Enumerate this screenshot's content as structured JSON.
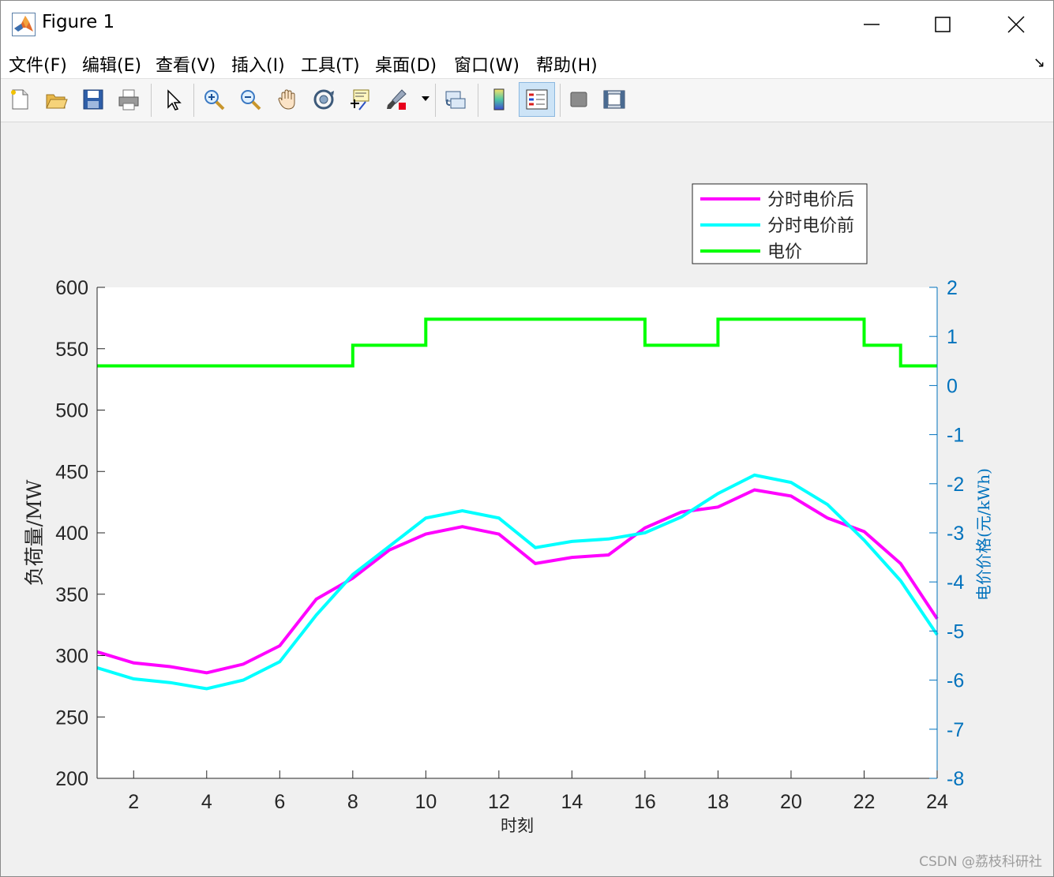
{
  "window": {
    "title": "Figure 1"
  },
  "menu": {
    "items": [
      "文件(F)",
      "编辑(E)",
      "查看(V)",
      "插入(I)",
      "工具(T)",
      "桌面(D)",
      "窗口(W)",
      "帮助(H)"
    ]
  },
  "toolbar": {
    "buttons": [
      {
        "name": "new-figure-icon"
      },
      {
        "name": "open-file-icon"
      },
      {
        "name": "save-icon"
      },
      {
        "name": "print-icon"
      },
      {
        "name": "edit-plot-arrow-icon"
      },
      {
        "name": "zoom-in-icon"
      },
      {
        "name": "zoom-out-icon"
      },
      {
        "name": "pan-hand-icon"
      },
      {
        "name": "rotate-3d-icon"
      },
      {
        "name": "data-cursor-icon"
      },
      {
        "name": "brush-icon"
      },
      {
        "name": "link-plot-icon"
      },
      {
        "name": "colorbar-icon"
      },
      {
        "name": "legend-icon"
      },
      {
        "name": "hide-plot-tools-icon"
      },
      {
        "name": "show-plot-tools-icon"
      }
    ]
  },
  "watermark": "CSDN @荔枝科研社",
  "chart_data": {
    "type": "line",
    "title": "",
    "xlabel": "时刻",
    "ylabel": "负荷量/MW",
    "ylabel_right": "电价价格(元/kWh)",
    "xlim": [
      1,
      24
    ],
    "ylim": [
      200,
      600
    ],
    "ylim_right": [
      -8,
      2
    ],
    "x_ticks": [
      2,
      4,
      6,
      8,
      10,
      12,
      14,
      16,
      18,
      20,
      22,
      24
    ],
    "y_ticks": [
      200,
      250,
      300,
      350,
      400,
      450,
      500,
      550,
      600
    ],
    "y_ticks_right": [
      -8,
      -7,
      -6,
      -5,
      -4,
      -3,
      -2,
      -1,
      0,
      1,
      2
    ],
    "grid": false,
    "legend_position": "top-right",
    "x": [
      1,
      2,
      3,
      4,
      5,
      6,
      7,
      8,
      9,
      10,
      11,
      12,
      13,
      14,
      15,
      16,
      17,
      18,
      19,
      20,
      21,
      22,
      23,
      24
    ],
    "series": [
      {
        "name": "分时电价后",
        "color": "#ff00ff",
        "axis": "left",
        "values": [
          303,
          294,
          291,
          286,
          293,
          308,
          346,
          363,
          386,
          399,
          405,
          399,
          375,
          380,
          382,
          404,
          417,
          421,
          435,
          430,
          412,
          401,
          375,
          330
        ]
      },
      {
        "name": "分时电价前",
        "color": "#00ffff",
        "axis": "left",
        "values": [
          290,
          281,
          278,
          273,
          280,
          295,
          333,
          366,
          389,
          412,
          418,
          412,
          388,
          393,
          395,
          400,
          413,
          432,
          447,
          441,
          423,
          394,
          361,
          317
        ]
      },
      {
        "name": "电价",
        "color": "#00ff00",
        "axis": "right",
        "step": true,
        "x": [
          1,
          8,
          8,
          10,
          10,
          16,
          16,
          18,
          18,
          22,
          22,
          23,
          23,
          24
        ],
        "values": [
          0.4,
          0.4,
          0.82,
          0.82,
          1.35,
          1.35,
          0.82,
          0.82,
          1.35,
          1.35,
          0.82,
          0.82,
          0.4,
          0.4
        ]
      }
    ]
  }
}
